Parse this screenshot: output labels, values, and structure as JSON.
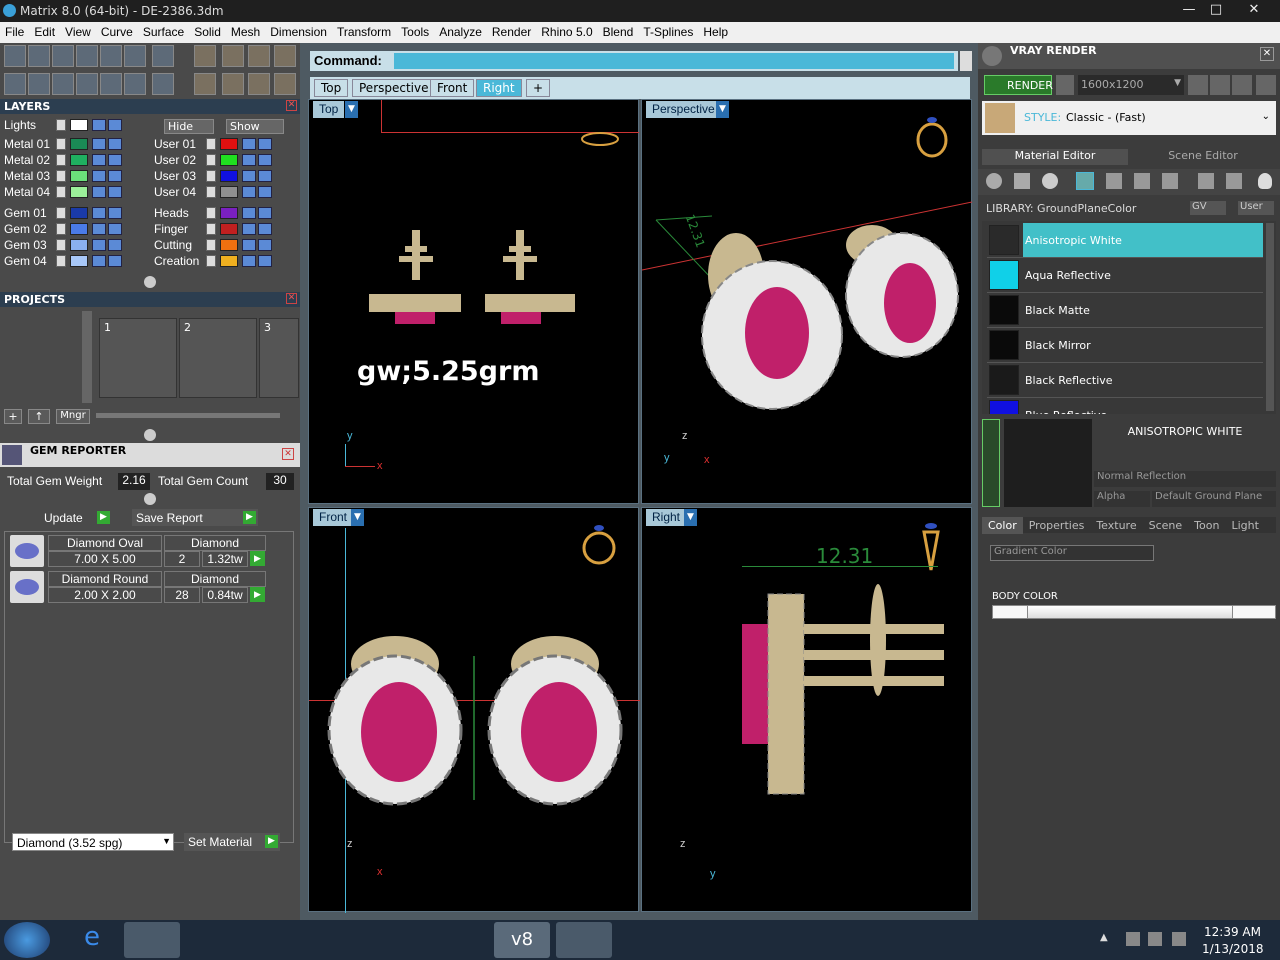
{
  "window": {
    "title": "Matrix 8.0 (64-bit) - DE-2386.3dm",
    "min": "—",
    "max": "□",
    "close": "✕"
  },
  "menu": [
    "File",
    "Edit",
    "View",
    "Curve",
    "Surface",
    "Solid",
    "Mesh",
    "Dimension",
    "Transform",
    "Tools",
    "Analyze",
    "Render",
    "Rhino 5.0",
    "Blend",
    "T-Splines",
    "Help"
  ],
  "layers": {
    "title": "LAYERS",
    "lights": "Lights",
    "hide": "Hide",
    "show": "Show",
    "left": [
      {
        "name": "Metal 01",
        "color": "#1a8a55"
      },
      {
        "name": "Metal 02",
        "color": "#1fb060"
      },
      {
        "name": "Metal 03",
        "color": "#6be07a"
      },
      {
        "name": "Metal 04",
        "color": "#9cf09a"
      },
      {
        "name": "Gem 01",
        "color": "#1a3aa8"
      },
      {
        "name": "Gem 02",
        "color": "#4a7be8"
      },
      {
        "name": "Gem 03",
        "color": "#8ab0f0"
      },
      {
        "name": "Gem 04",
        "color": "#a8c8f8"
      }
    ],
    "right": [
      {
        "name": "User 01",
        "color": "#e01010"
      },
      {
        "name": "User 02",
        "color": "#20e020"
      },
      {
        "name": "User 03",
        "color": "#1010e0"
      },
      {
        "name": "User 04",
        "color": "#909090"
      },
      {
        "name": "Heads",
        "color": "#7a20c0"
      },
      {
        "name": "Finger",
        "color": "#c02020"
      },
      {
        "name": "Cutting",
        "color": "#f07010"
      },
      {
        "name": "Creation",
        "color": "#f0b020"
      }
    ]
  },
  "projects": {
    "title": "PROJECTS",
    "slots": [
      "1",
      "2",
      "3"
    ],
    "mngr": "Mngr"
  },
  "gem_reporter": {
    "title": "GEM REPORTER",
    "weight_label": "Total Gem Weight",
    "weight": "2.16",
    "count_label": "Total Gem Count",
    "count": "30",
    "update": "Update",
    "save_report": "Save Report",
    "rows": [
      {
        "shape": "Diamond Oval",
        "size": "7.00 X 5.00",
        "material": "Diamond",
        "qty": "2",
        "tw": "1.32tw"
      },
      {
        "shape": "Diamond Round",
        "size": "2.00 X 2.00",
        "material": "Diamond",
        "qty": "28",
        "tw": "0.84tw"
      }
    ],
    "material_select": "Diamond    (3.52 spg)",
    "set_material": "Set Material"
  },
  "command": {
    "label": "Command:"
  },
  "view_tabs": [
    "Top",
    "Perspective",
    "Front",
    "Right",
    "+"
  ],
  "viewports": {
    "top": {
      "label": "Top",
      "annotation": "gw;5.25grm",
      "axis_y": "y",
      "axis_x": "x"
    },
    "perspective": {
      "label": "Perspective",
      "dim": "12.31",
      "axis_z": "z",
      "axis_y": "y",
      "axis_x": "x"
    },
    "front": {
      "label": "Front",
      "axis_z": "z",
      "axis_x": "x"
    },
    "right": {
      "label": "Right",
      "dim": "12.31",
      "axis_z": "z",
      "axis_y": "y"
    }
  },
  "vray": {
    "title": "VRAY RENDER",
    "render": "RENDER",
    "resolution": "1600x1200",
    "style_label": "STYLE:",
    "style": "Classic - (Fast)",
    "tabs": [
      "Material Editor",
      "Scene Editor"
    ],
    "library_label": "LIBRARY: GroundPlaneColor",
    "gv": "GV",
    "user": "User",
    "materials": [
      {
        "name": "Anisotropic White",
        "color": "#2a2a2a",
        "selected": true
      },
      {
        "name": "Aqua Reflective",
        "color": "#10d0e8",
        "selected": false
      },
      {
        "name": "Black Matte",
        "color": "#0a0a0a",
        "selected": false
      },
      {
        "name": "Black Mirror",
        "color": "#0a0a0a",
        "selected": false
      },
      {
        "name": "Black Reflective",
        "color": "#1a1a1a",
        "selected": false
      },
      {
        "name": "Blue Reflective",
        "color": "#1010e0",
        "selected": false
      }
    ],
    "preview_name": "ANISOTROPIC WHITE",
    "reflection": "Normal Reflection",
    "alpha": "Alpha",
    "ground_plane": "Default Ground Plane",
    "prop_tabs": [
      "Color",
      "Properties",
      "Texture",
      "Scene",
      "Toon",
      "Light"
    ],
    "gradient": "Gradient Color",
    "body_color": "BODY COLOR"
  },
  "taskbar": {
    "time": "12:39 AM",
    "date": "1/13/2018"
  }
}
